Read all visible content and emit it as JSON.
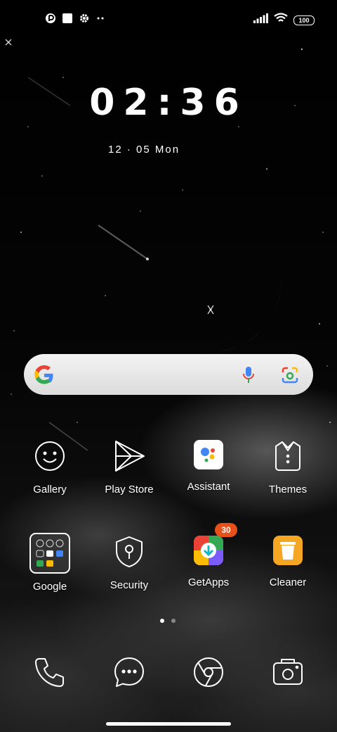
{
  "status_bar": {
    "left_icons": [
      "app-notification-icon",
      "square-notification-icon",
      "settings-icon",
      "more-dots-icon"
    ],
    "right_icons": [
      "signal-icon",
      "wifi-icon",
      "battery-icon"
    ],
    "battery_level": "100"
  },
  "clock": {
    "time": "02:36",
    "date_text": "12 · 05  Mon"
  },
  "search_bar": {
    "icons": [
      "google-g-icon",
      "microphone-icon",
      "lens-camera-icon"
    ]
  },
  "apps_row1": [
    {
      "label": "Gallery"
    },
    {
      "label": "Play Store"
    },
    {
      "label": "Assistant"
    },
    {
      "label": "Themes"
    }
  ],
  "apps_row2": [
    {
      "label": "Google"
    },
    {
      "label": "Security"
    },
    {
      "label": "GetApps",
      "badge": "30"
    },
    {
      "label": "Cleaner"
    }
  ],
  "page_indicator": {
    "pages": 2,
    "current": 1
  },
  "dock": [
    "phone-icon",
    "messages-icon",
    "browser-icon",
    "camera-icon"
  ],
  "colors": {
    "badge": "#e8501a",
    "cleaner": "#f5a623",
    "google_blue": "#4285F4",
    "google_red": "#EA4335",
    "google_yellow": "#FBBC05",
    "google_green": "#34A853"
  }
}
